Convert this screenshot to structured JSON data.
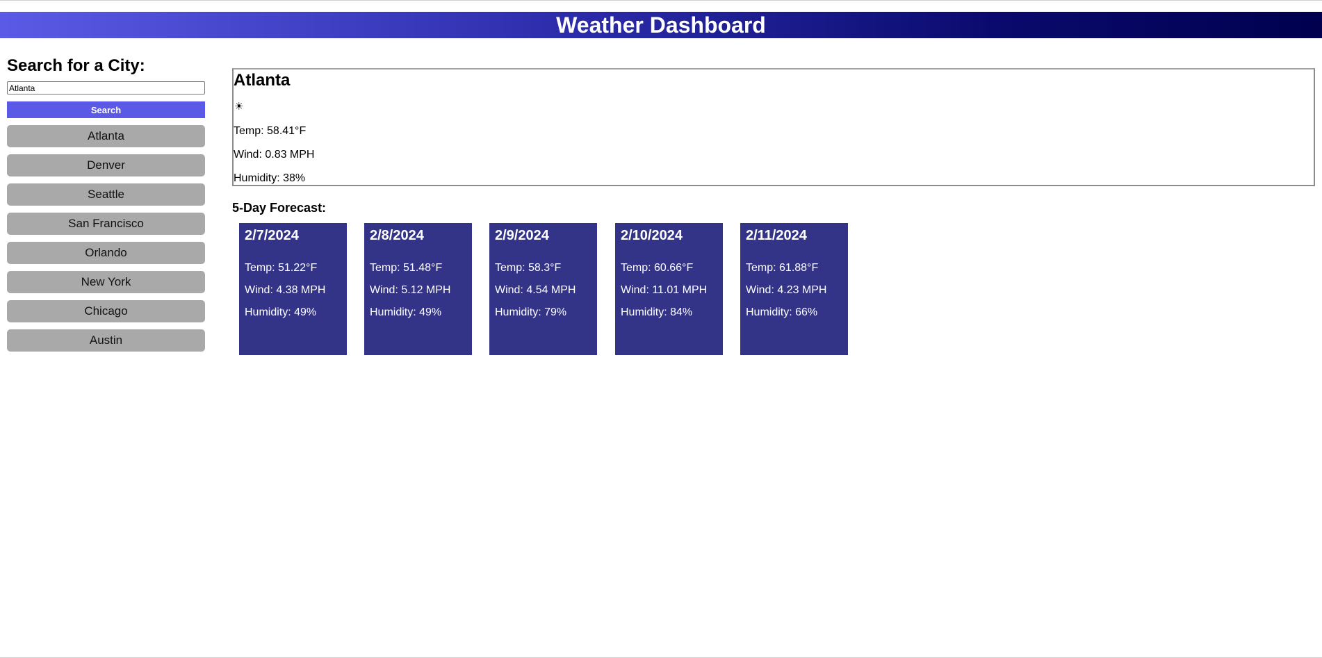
{
  "header": {
    "title": "Weather Dashboard"
  },
  "sidebar": {
    "heading": "Search for a City:",
    "search_value": "Atlanta",
    "search_button_label": "Search",
    "history": [
      "Atlanta",
      "Denver",
      "Seattle",
      "San Francisco",
      "Orlando",
      "New York",
      "Chicago",
      "Austin"
    ]
  },
  "current": {
    "city": "Atlanta",
    "icon": "☀",
    "temp": "Temp: 58.41°F",
    "wind": "Wind: 0.83 MPH",
    "humidity": "Humidity: 38%"
  },
  "forecast": {
    "heading": "5-Day Forecast:",
    "days": [
      {
        "date": "2/7/2024",
        "temp": "Temp: 51.22°F",
        "wind": "Wind: 4.38 MPH",
        "humidity": "Humidity: 49%"
      },
      {
        "date": "2/8/2024",
        "temp": "Temp: 51.48°F",
        "wind": "Wind: 5.12 MPH",
        "humidity": "Humidity: 49%"
      },
      {
        "date": "2/9/2024",
        "temp": "Temp: 58.3°F",
        "wind": "Wind: 4.54 MPH",
        "humidity": "Humidity: 79%"
      },
      {
        "date": "2/10/2024",
        "temp": "Temp: 60.66°F",
        "wind": "Wind: 11.01 MPH",
        "humidity": "Humidity: 84%"
      },
      {
        "date": "2/11/2024",
        "temp": "Temp: 61.88°F",
        "wind": "Wind: 4.23 MPH",
        "humidity": "Humidity: 66%"
      }
    ]
  },
  "colors": {
    "accent": "#5a5ae6",
    "card_background": "#333388",
    "history_button": "#a9a9a9",
    "header_gradient_end": "#00004f"
  }
}
